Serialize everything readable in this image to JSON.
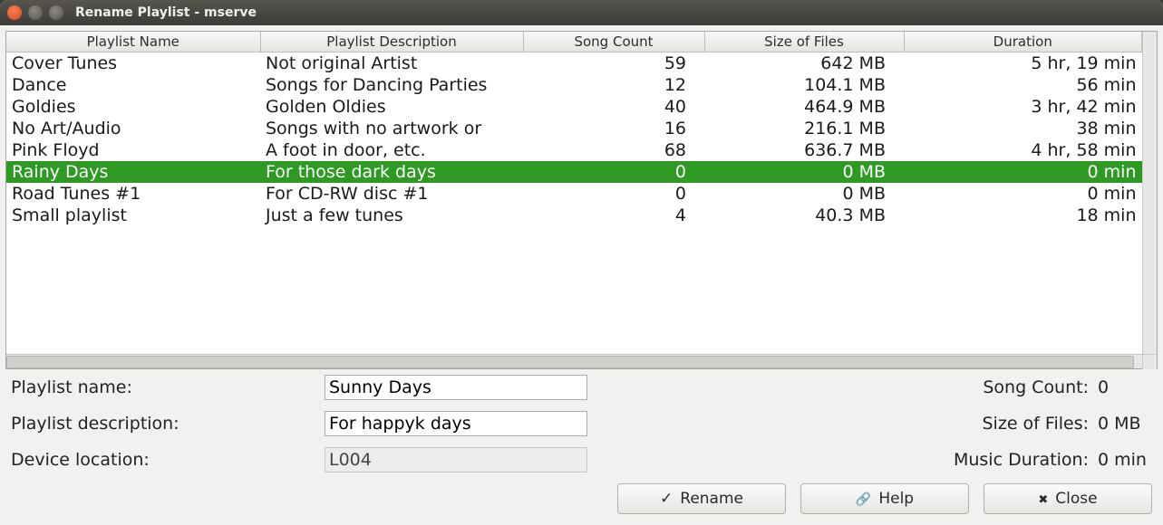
{
  "window": {
    "title": "Rename Playlist - mserve"
  },
  "table": {
    "headers": {
      "name": "Playlist Name",
      "desc": "Playlist Description",
      "count": "Song Count",
      "size": "Size of Files",
      "dur": "Duration"
    },
    "rows": [
      {
        "name": "Cover Tunes",
        "desc": "Not original Artist",
        "count": "59",
        "size": "642 MB",
        "dur": "5 hr, 19 min",
        "selected": false
      },
      {
        "name": "Dance",
        "desc": "Songs for Dancing Parties",
        "count": "12",
        "size": "104.1 MB",
        "dur": "56 min",
        "selected": false
      },
      {
        "name": "Goldies",
        "desc": "Golden Oldies",
        "count": "40",
        "size": "464.9 MB",
        "dur": "3 hr, 42 min",
        "selected": false
      },
      {
        "name": "No Art/Audio",
        "desc": "Songs with no artwork or",
        "count": "16",
        "size": "216.1 MB",
        "dur": "38 min",
        "selected": false
      },
      {
        "name": "Pink Floyd",
        "desc": "A foot in door, etc.",
        "count": "68",
        "size": "636.7 MB",
        "dur": "4 hr, 58 min",
        "selected": false
      },
      {
        "name": "Rainy Days",
        "desc": "For those dark days",
        "count": "0",
        "size": "0 MB",
        "dur": "0 min",
        "selected": true
      },
      {
        "name": "Road Tunes #1",
        "desc": "For CD-RW disc #1",
        "count": "0",
        "size": "0 MB",
        "dur": "0 min",
        "selected": false
      },
      {
        "name": "Small playlist",
        "desc": "Just a few tunes",
        "count": "4",
        "size": "40.3 MB",
        "dur": "18 min",
        "selected": false
      }
    ]
  },
  "form": {
    "name_label": "Playlist name:",
    "name_value": "Sunny Days",
    "desc_label": "Playlist description:",
    "desc_value": "For happyk days",
    "device_label": "Device location:",
    "device_value": "L004"
  },
  "info": {
    "count_label": "Song Count:",
    "count_value": "0",
    "size_label": "Size of Files:",
    "size_value": "0 MB",
    "dur_label": "Music Duration:",
    "dur_value": "0 min"
  },
  "buttons": {
    "rename": "Rename",
    "help": "Help",
    "close": "Close"
  }
}
